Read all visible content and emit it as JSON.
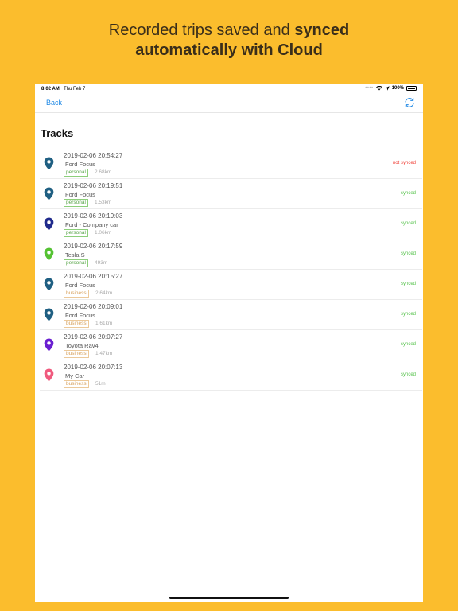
{
  "promo": {
    "line1_prefix": "Recorded trips saved and ",
    "line1_bold": "synced",
    "line2": "automatically with Cloud"
  },
  "statusbar": {
    "time": "8:02 AM",
    "date": "Thu Feb 7",
    "battery": "100%",
    "icons": [
      "wifi-icon",
      "location-arrow-icon",
      "battery-icon"
    ]
  },
  "navbar": {
    "back_label": "Back",
    "sync_icon": "refresh-icon",
    "accent": "#1e88e5"
  },
  "page_title": "Tracks",
  "tracks": [
    {
      "datetime": "2019-02-06 20:54:27",
      "car": "Ford Focus",
      "tag": "personal",
      "distance": "2.68km",
      "status": "not synced",
      "pin_color": "#1f5f82"
    },
    {
      "datetime": "2019-02-06 20:19:51",
      "car": "Ford Focus",
      "tag": "personal",
      "distance": "1.53km",
      "status": "synced",
      "pin_color": "#1f5f82"
    },
    {
      "datetime": "2019-02-06 20:19:03",
      "car": "Ford - Company car",
      "tag": "personal",
      "distance": "1.06km",
      "status": "synced",
      "pin_color": "#1f2a8c"
    },
    {
      "datetime": "2019-02-06 20:17:59",
      "car": "Tesla S",
      "tag": "personal",
      "distance": "493m",
      "status": "synced",
      "pin_color": "#55c233"
    },
    {
      "datetime": "2019-02-06 20:15:27",
      "car": "Ford Focus",
      "tag": "business",
      "distance": "2.64km",
      "status": "synced",
      "pin_color": "#1f5f82"
    },
    {
      "datetime": "2019-02-06 20:09:01",
      "car": "Ford Focus",
      "tag": "business",
      "distance": "1.61km",
      "status": "synced",
      "pin_color": "#1f5f82"
    },
    {
      "datetime": "2019-02-06 20:07:27",
      "car": "Toyota Rav4",
      "tag": "business",
      "distance": "1.47km",
      "status": "synced",
      "pin_color": "#6a1fd1"
    },
    {
      "datetime": "2019-02-06 20:07:13",
      "car": "My Car",
      "tag": "business",
      "distance": "51m",
      "status": "synced",
      "pin_color": "#f05a7e"
    }
  ]
}
